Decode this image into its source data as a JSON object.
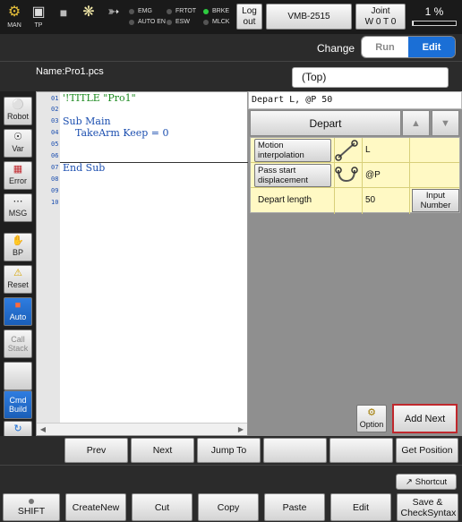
{
  "topbar": {
    "man_label": "MAN",
    "tp_label": "TP",
    "leds": [
      {
        "label": "EMG",
        "on": false
      },
      {
        "label": "AUTO EN",
        "on": false
      },
      {
        "label": "FRTOT",
        "on": false
      },
      {
        "label": "ESW",
        "on": false
      },
      {
        "label": "BRKE",
        "on": true
      },
      {
        "label": "MLCK",
        "on": false
      }
    ],
    "logout_label": "Log out",
    "robot_model": "VMB-2515",
    "jog_mode": "Joint",
    "tool_work": "W 0 T 0",
    "speed_text": "1 %",
    "speed_fraction": 0.01
  },
  "changebar": {
    "change_label": "Change",
    "run_label": "Run",
    "edit_label": "Edit",
    "active": "Edit"
  },
  "namebar": {
    "name_label": "Name:Pro1.pcs",
    "scope_value": "(Top)"
  },
  "sidebar": {
    "robot": "Robot",
    "var": "Var",
    "error": "Error",
    "msg": "MSG",
    "bp": "BP",
    "reset": "Reset",
    "auto": "Auto",
    "call_stack": "Call Stack",
    "cmd_build": "Cmd Build"
  },
  "editor": {
    "line_numbers": [
      "01",
      "02",
      "03",
      "04",
      "05",
      "06",
      "07",
      "08",
      "09",
      "10"
    ],
    "lines": [
      "'!TITLE \"Pro1\"",
      "",
      "Sub Main",
      "    TakeArm Keep = 0",
      "",
      "",
      "End Sub",
      "",
      "",
      ""
    ]
  },
  "panel": {
    "command_line": "Depart L, @P 50",
    "command_name": "Depart",
    "params": [
      {
        "button": "Motion interpolation",
        "value": "L"
      },
      {
        "button": "Pass start displacement",
        "value": "@P"
      },
      {
        "label": "Depart length",
        "value": "50",
        "action": "Input Number"
      }
    ],
    "option_label": "Option",
    "add_next_label": "Add Next"
  },
  "navbar": {
    "prev": "Prev",
    "next": "Next",
    "jump_to": "Jump To",
    "get_position": "Get Position"
  },
  "bottombar": {
    "shortcut": "Shortcut",
    "shift": "SHIFT",
    "create_new": "CreateNew",
    "cut": "Cut",
    "copy": "Copy",
    "paste": "Paste",
    "edit": "Edit",
    "save_check": "Save & CheckSyntax"
  },
  "colors": {
    "edit_active": "#1b6fd6",
    "param_bg": "#fff9c4",
    "led_on": "#2ecc40",
    "add_next_border": "#c0282d"
  }
}
